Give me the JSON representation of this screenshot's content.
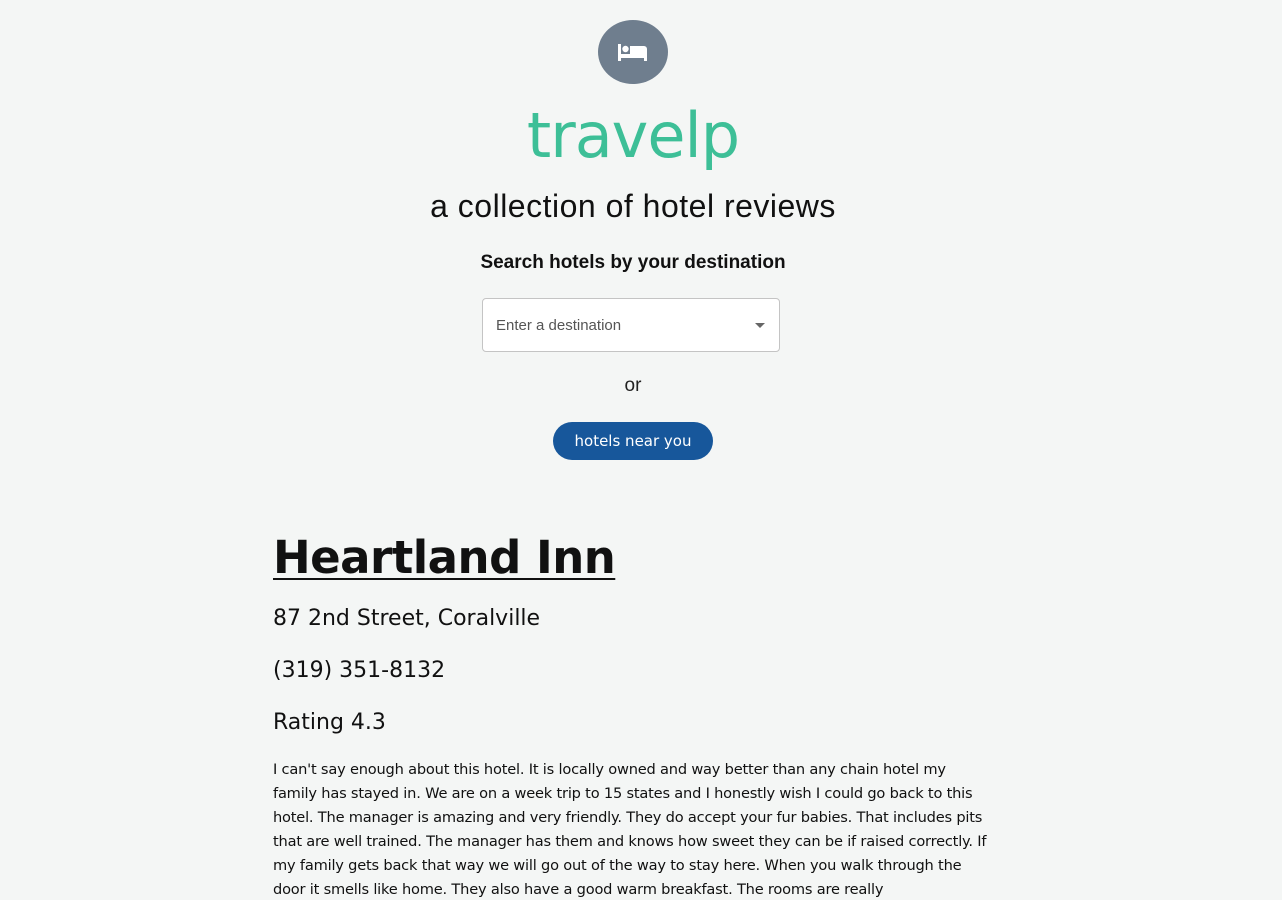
{
  "header": {
    "logo_icon": "bed-icon",
    "brand": "travelp",
    "tagline": "a collection of hotel reviews",
    "brand_color": "#3dbf97"
  },
  "search": {
    "heading": "Search hotels by your destination",
    "placeholder": "Enter a destination",
    "or_text": "or",
    "near_button_label": "hotels near you",
    "near_button_color": "#17579b"
  },
  "hotel": {
    "name": "Heartland Inn",
    "address": "87 2nd Street, Coralville",
    "phone": "(319) 351-8132",
    "rating_text": "Rating 4.3",
    "rating": 4.3,
    "review": "I can't say enough about this hotel. It is locally owned and way better than any chain hotel my family has stayed in. We are on a week trip to 15 states and I honestly wish I could go back to this hotel. The manager is amazing and very friendly. They do accept your fur babies. That includes pits that are well trained. The manager has them and knows how sweet they can be if raised correctly. If my family gets back that way we will go out of the way to stay here. When you walk through the door it smells like home. They also have a good warm breakfast. The rooms are really"
  }
}
